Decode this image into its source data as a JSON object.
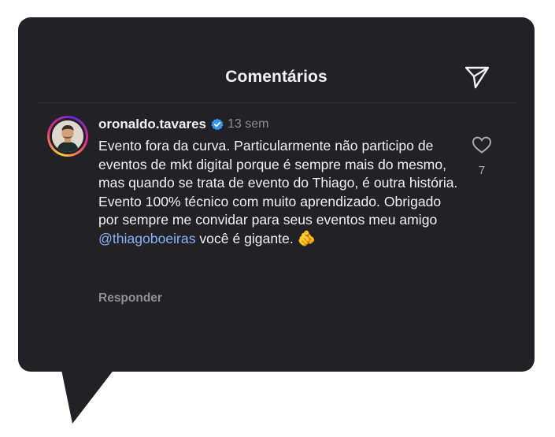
{
  "header": {
    "title": "Comentários",
    "send_icon": "paper-plane-icon"
  },
  "comment": {
    "avatar_icon": "profile-photo",
    "username": "oronaldo.tavares",
    "verified_icon": "verified-badge-icon",
    "time": "13 sem",
    "text_before": "Evento fora da curva. Particularmente não participo de eventos de mkt digital porque é sempre mais do mesmo, mas quando se trata de evento do Thiago, é outra história. Evento 100% técnico com muito aprendizado. Obrigado por sempre me convidar para seus eventos meu amigo ",
    "mention": "@thiagoboeiras",
    "text_after": " você é gigante. ",
    "emoji": "🫵",
    "reply_label": "Responder",
    "like_icon": "heart-outline-icon",
    "like_count": "7"
  },
  "colors": {
    "card_background": "#222226",
    "primary_text": "#f2f2f2",
    "secondary_text": "#8e8e93",
    "mention": "#8ab4f8",
    "verified": "#3897f0"
  }
}
